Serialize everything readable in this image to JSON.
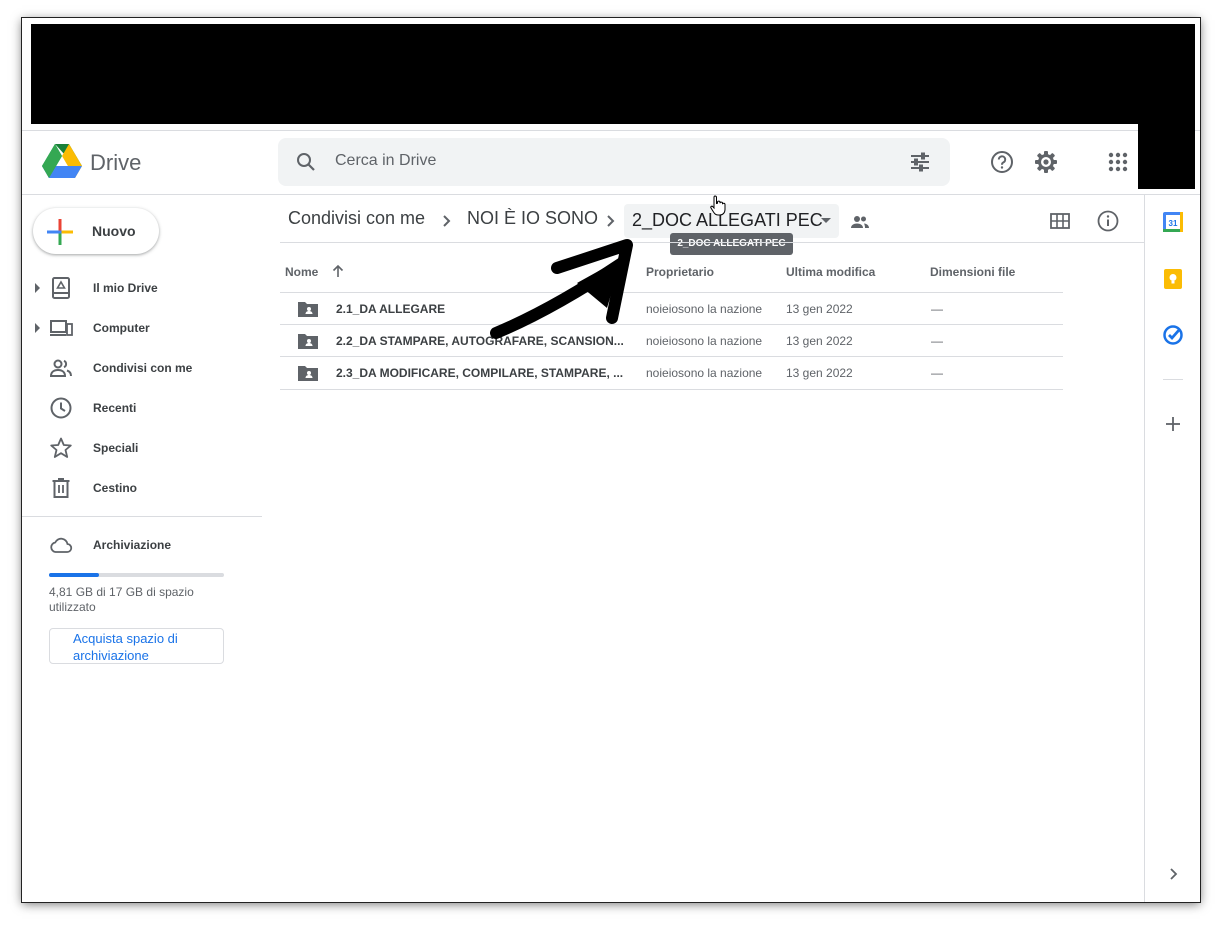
{
  "header": {
    "brand": "Drive",
    "search_placeholder": "Cerca in Drive"
  },
  "sidebar": {
    "new_label": "Nuovo",
    "items": [
      {
        "label": "Il mio Drive"
      },
      {
        "label": "Computer"
      },
      {
        "label": "Condivisi con me"
      },
      {
        "label": "Recenti"
      },
      {
        "label": "Speciali"
      },
      {
        "label": "Cestino"
      }
    ],
    "storage": {
      "label": "Archiviazione",
      "usage_text": "4,81 GB di 17 GB di spazio utilizzato",
      "used_fraction": 0.283,
      "buy_label": "Acquista spazio di archiviazione"
    }
  },
  "breadcrumb": {
    "items": [
      "Condivisi con me",
      "NOI È IO SONO",
      "2_DOC ALLEGATI PEC"
    ],
    "tooltip": "2_DOC ALLEGATI PEC"
  },
  "table": {
    "headers": [
      "Nome",
      "Proprietario",
      "Ultima modifica",
      "Dimensioni file"
    ],
    "rows": [
      {
        "name": "2.1_DA ALLEGARE",
        "owner": "noieiosono la nazione",
        "modified": "13 gen 2022",
        "size": "—"
      },
      {
        "name": "2.2_DA STAMPARE, AUTOGRAFARE, SCANSION...",
        "owner": "noieiosono la nazione",
        "modified": "13 gen 2022",
        "size": "—"
      },
      {
        "name": "2.3_DA MODIFICARE, COMPILARE, STAMPARE, ...",
        "owner": "noieiosono la nazione",
        "modified": "13 gen 2022",
        "size": "—"
      }
    ]
  },
  "rail": {
    "calendar_day": "31"
  },
  "colors": {
    "accent": "#1a73e8",
    "text": "#3c4043",
    "muted": "#5f6368"
  }
}
